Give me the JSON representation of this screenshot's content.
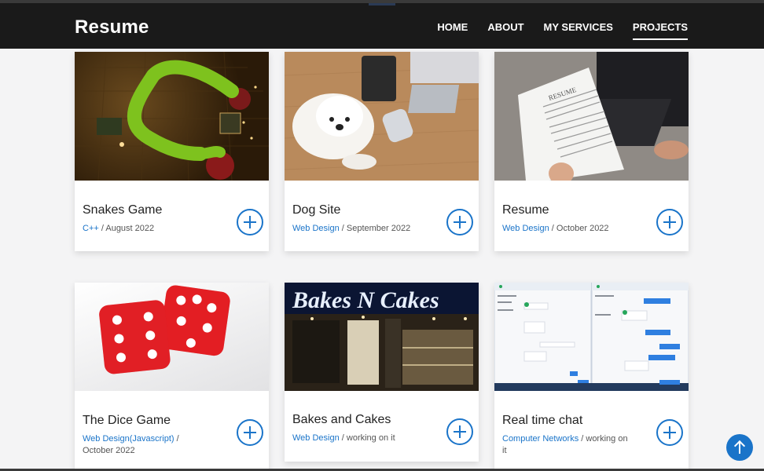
{
  "header": {
    "brand": "Resume",
    "nav": [
      {
        "label": "HOME"
      },
      {
        "label": "ABOUT"
      },
      {
        "label": "MY SERVICES"
      },
      {
        "label": "PROJECTS",
        "active": true
      }
    ]
  },
  "projects": [
    {
      "title": "Snakes Game",
      "category": "C++",
      "date": " / August 2022"
    },
    {
      "title": "Dog Site",
      "category": "Web Design",
      "date": " / September 2022"
    },
    {
      "title": "Resume",
      "category": "Web Design",
      "date": " / October 2022"
    },
    {
      "title": "The Dice Game",
      "category": "Web Design(Javascript)",
      "date": " / October 2022"
    },
    {
      "title": "Bakes and Cakes",
      "category": "Web Design",
      "date": " / working on it"
    },
    {
      "title": "Real time chat",
      "category": "Computer Networks",
      "date": " / working on it"
    }
  ],
  "thumbnail_text": {
    "resume_heading": "RESUME",
    "bakes_sign": "Bakes N Cakes"
  },
  "colors": {
    "header_bg": "#1a1a1a",
    "accent": "#1a74c9"
  }
}
